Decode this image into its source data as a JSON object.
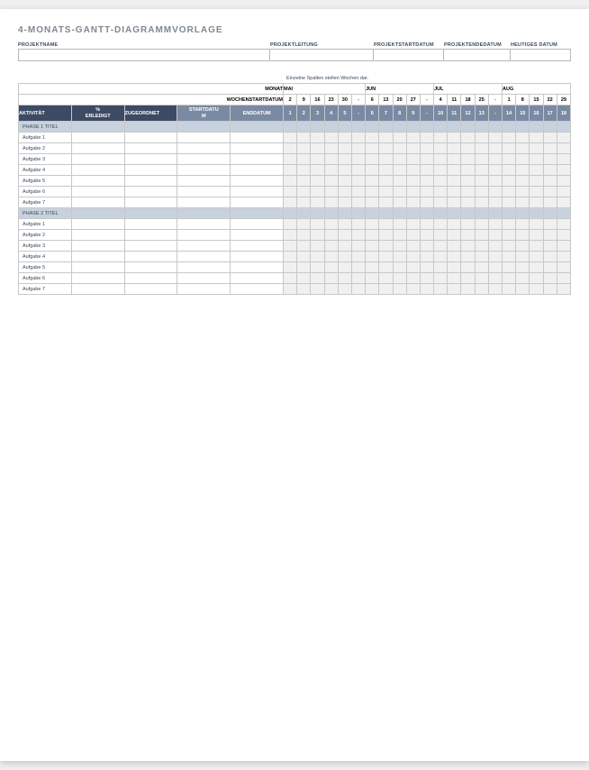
{
  "title": "4-MONATS-GANTT-DIAGRAMMVORLAGE",
  "info": {
    "name": "PROJEKTNAME",
    "lead": "PROJEKTLEITUNG",
    "start": "PROJEKTSTARTDATUM",
    "end": "PROJEKTENDEDATUM",
    "today": "HEUTIGES DATUM"
  },
  "note": "Einzelne Spalten stellen Wochen dar.",
  "labels": {
    "monat": "MONAT",
    "wsd": "WOCHENSTARTDATUM",
    "activity": "AKTIVITÄT",
    "pct": "% ERLEDIGT",
    "assign": "ZUGEORDNET",
    "startd": "STARTDATUM",
    "endd": "ENDDATUM"
  },
  "months": [
    {
      "name": "MAI",
      "dates": [
        "2",
        "9",
        "16",
        "23",
        "30",
        "-"
      ],
      "nums": [
        "1",
        "2",
        "3",
        "4",
        "5",
        "-"
      ]
    },
    {
      "name": "JUN",
      "dates": [
        "6",
        "13",
        "20",
        "27",
        "-"
      ],
      "nums": [
        "6",
        "7",
        "8",
        "9",
        "-"
      ]
    },
    {
      "name": "JUL",
      "dates": [
        "4",
        "11",
        "18",
        "25",
        "-"
      ],
      "nums": [
        "10",
        "11",
        "12",
        "13",
        "-"
      ]
    },
    {
      "name": "AUG",
      "dates": [
        "1",
        "8",
        "15",
        "22",
        "29"
      ],
      "nums": [
        "14",
        "15",
        "16",
        "17",
        "18"
      ]
    }
  ],
  "phases": [
    {
      "title": "PHASE 1 TITEL",
      "tasks": [
        "Aufgabe 1",
        "Aufgabe 2",
        "Aufgabe 3",
        "Aufgabe 4",
        "Aufgabe 5",
        "Aufgabe 6",
        "Aufgabe 7"
      ]
    },
    {
      "title": "PHASE 2 TITEL",
      "tasks": [
        "Aufgabe 1",
        "Aufgabe 2",
        "Aufgabe 3",
        "Aufgabe 4",
        "Aufgabe 5",
        "Aufgabe 6",
        "Aufgabe 7"
      ]
    }
  ]
}
